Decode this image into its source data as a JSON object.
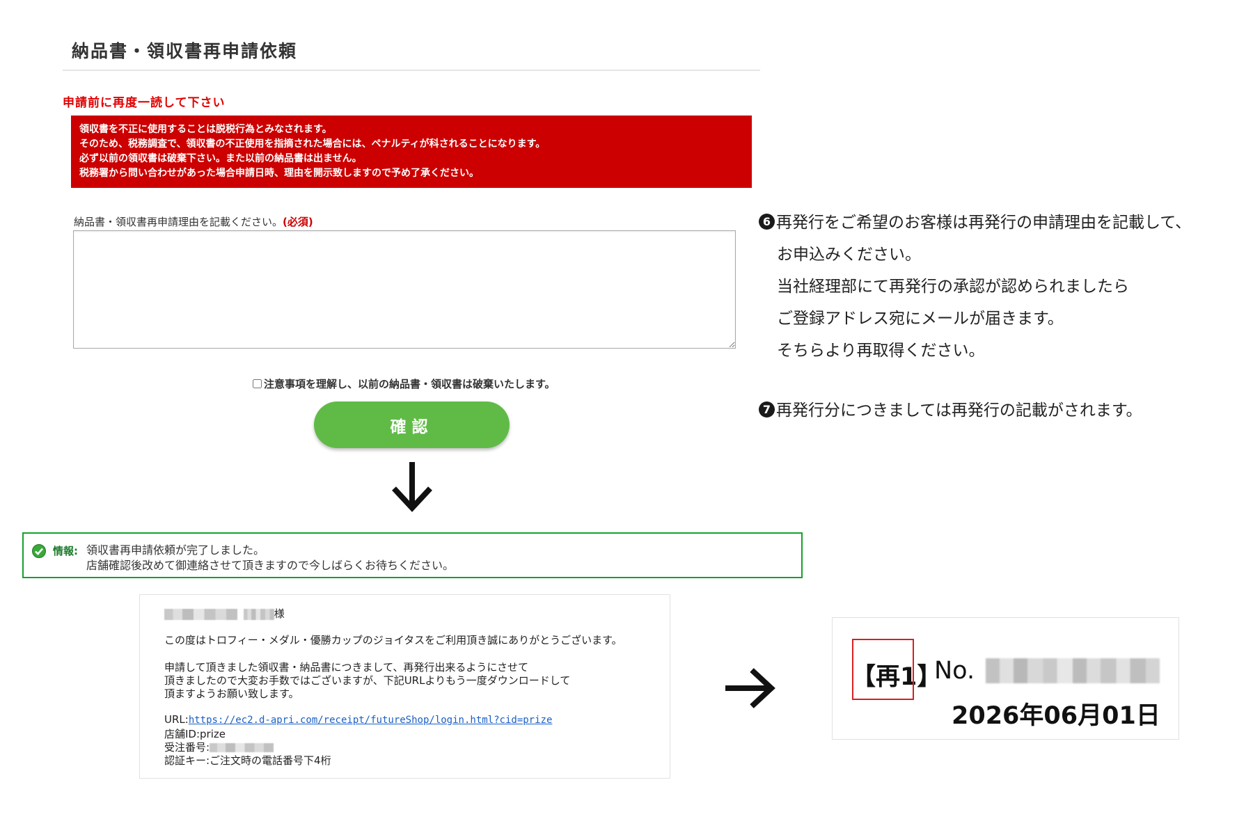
{
  "form": {
    "title": "納品書・領収書再申請依頼",
    "notice_heading": "申請前に再度一読して下さい",
    "warning_lines": [
      "領収書を不正に使用することは脱税行為とみなされます。",
      "そのため、税務調査で、領収書の不正使用を指摘された場合には、ペナルティが科されることになります。",
      "必ず以前の領収書は破棄下さい。また以前の納品書は出ません。",
      "税務署から問い合わせがあった場合申請日時、理由を開示致しますので予め了承ください。"
    ],
    "reason_label": "納品書・領収書再申請理由を記載ください。",
    "required_label": "(必須)",
    "reason_value": "",
    "agree_label": "注意事項を理解し、以前の納品書・領収書は破棄いたします。",
    "confirm_button": "確認"
  },
  "info": {
    "tag": "情報:",
    "line1": "領収書再申請依頼が完了しました。",
    "line2": "店舗確認後改めて御連絡させて頂きますので今しばらくお待ちください。"
  },
  "email": {
    "honorific": "様",
    "line_thanks": "この度はトロフィー・メダル・優勝カップのジョイタスをご利用頂き誠にありがとうございます。",
    "line_body1": "申請して頂きました領収書・納品書につきまして、再発行出来るようにさせて",
    "line_body2": "頂きましたので大変お手数ではございますが、下記URLよりもう一度ダウンロードして",
    "line_body3": "頂ますようお願い致します。",
    "url_label": "URL:",
    "url": "https://ec2.d-apri.com/receipt/futureShop/login.html?cid=prize",
    "store_id": "店舗ID:prize",
    "order_label": "受注番号:",
    "auth_key": "認証キー:ご注文時の電話番号下4桁"
  },
  "receipt": {
    "reissue_mark": "【再1】",
    "no_label": "No.",
    "date": "2026年06月01日"
  },
  "notes": {
    "num6": "6",
    "line6_1": "再発行をご希望のお客様は再発行の申請理由を記載して、",
    "line6_2": "お申込みください。",
    "line6_3": "当社経理部にて再発行の承認が認められましたら",
    "line6_4": "ご登録アドレス宛にメールが届きます。",
    "line6_5": "そちらより再取得ください。",
    "num7": "7",
    "line7": "再発行分につきましては再発行の記載がされます。"
  },
  "colors": {
    "warning_bg": "#cc0000",
    "confirm_green": "#60bb46",
    "info_border": "#15a02b",
    "highlight_red": "#d62020"
  },
  "icons": [
    "check-circle-icon",
    "arrow-down-icon",
    "arrow-right-icon"
  ]
}
